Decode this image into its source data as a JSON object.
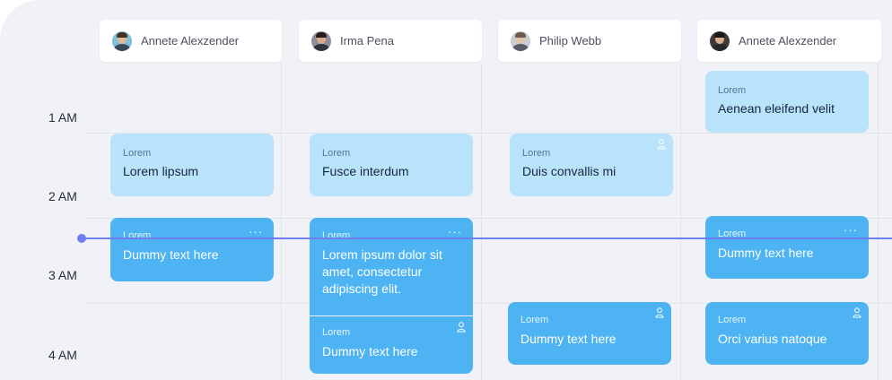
{
  "hours": [
    "1 AM",
    "2 AM",
    "3 AM",
    "4 AM"
  ],
  "columns": [
    {
      "name": "Annete Alexzender",
      "avatar": "avatar-annete"
    },
    {
      "name": "Irma Pena",
      "avatar": "avatar-irma"
    },
    {
      "name": "Philip Webb",
      "avatar": "avatar-philip"
    },
    {
      "name": "Annete Alexzender",
      "avatar": "avatar-annete-2"
    }
  ],
  "events": [
    {
      "tag": "Lorem",
      "title": "Aenean eleifend velit",
      "style": "light",
      "icons": []
    },
    {
      "tag": "Lorem",
      "title": "Lorem lipsum",
      "style": "light",
      "icons": []
    },
    {
      "tag": "Lorem",
      "title": "Fusce interdum",
      "style": "light",
      "icons": []
    },
    {
      "tag": "Lorem",
      "title": "Duis convallis mi",
      "style": "light",
      "icons": [
        "person-icon"
      ]
    },
    {
      "tag": "Lorem",
      "title": "Dummy text here",
      "style": "dark",
      "icons": [
        "more-icon"
      ]
    },
    {
      "tag": "Lorem",
      "title": "Lorem ipsum dolor sit amet, consectetur adipiscing elit.",
      "style": "dark",
      "icons": [
        "more-icon"
      ]
    },
    {
      "tag": "Lorem",
      "title": "Dummy text here",
      "style": "dark",
      "icons": [
        "more-icon"
      ]
    },
    {
      "tag": "Lorem",
      "title": "Dummy text here",
      "style": "dark",
      "icons": [
        "person-icon"
      ]
    },
    {
      "tag": "Lorem",
      "title": "Dummy text here",
      "style": "dark",
      "icons": [
        "person-icon"
      ]
    },
    {
      "tag": "Lorem",
      "title": "Orci varius natoque",
      "style": "dark",
      "icons": [
        "person-icon"
      ]
    }
  ],
  "more_glyph": "···",
  "colors": {
    "background": "#f1f2f7",
    "event_light": "#b9e2fb",
    "event_dark": "#4db3f3",
    "now_indicator": "#6d7ff0"
  }
}
